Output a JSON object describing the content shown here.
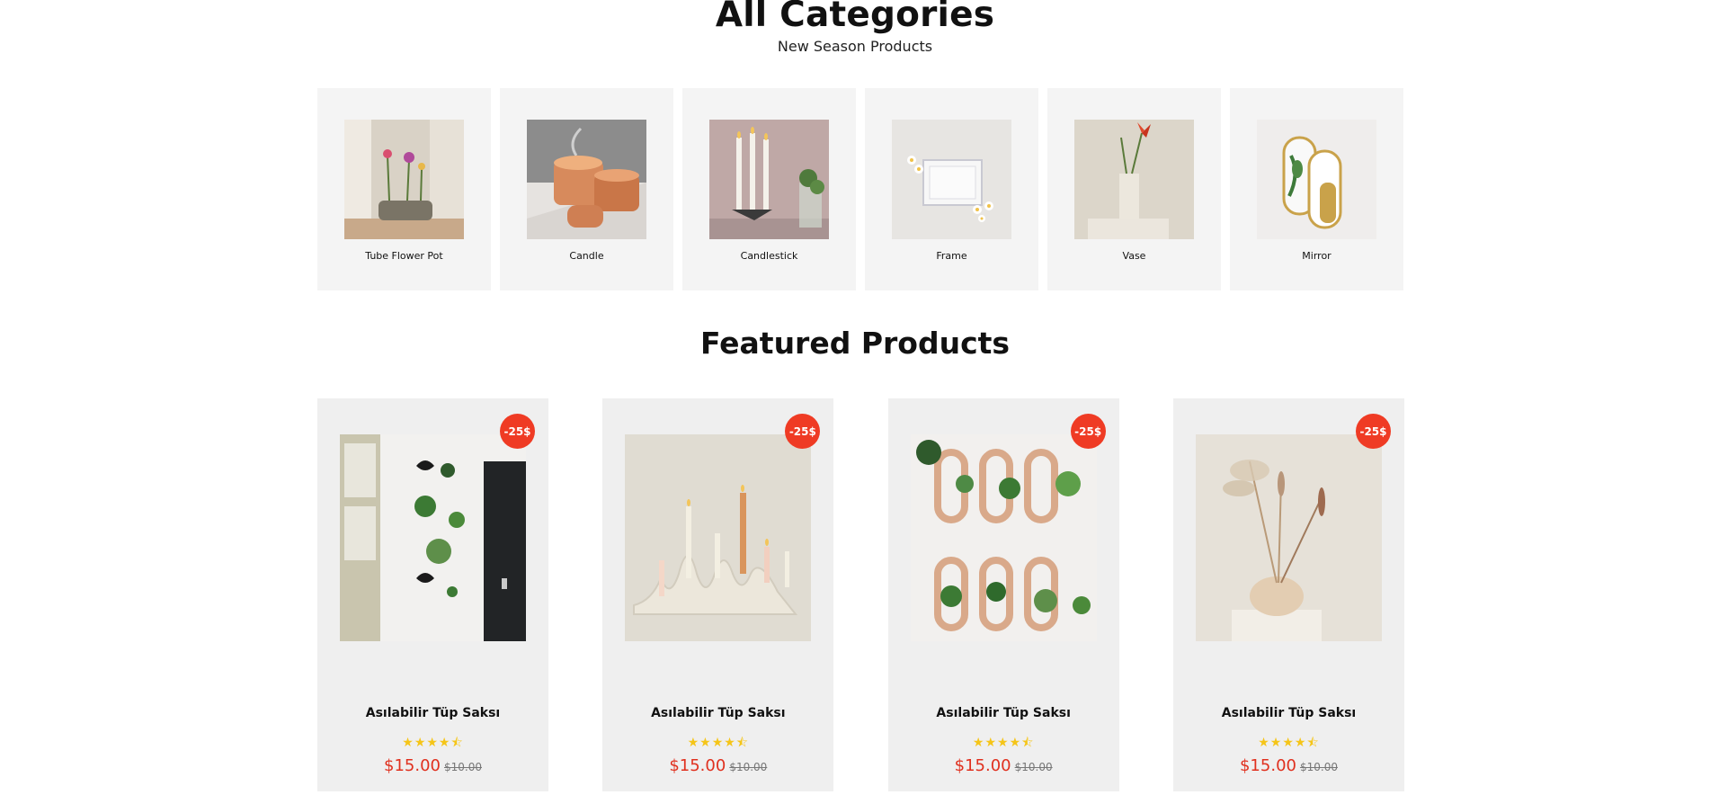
{
  "categories_section": {
    "title": "All Categories",
    "subtitle": "New Season Products",
    "items": [
      {
        "label": "Tube Flower Pot",
        "icon": "tube-flower-pot-image"
      },
      {
        "label": "Candle",
        "icon": "candle-image"
      },
      {
        "label": "Candlestick",
        "icon": "candlestick-image"
      },
      {
        "label": "Frame",
        "icon": "frame-image"
      },
      {
        "label": "Vase",
        "icon": "vase-image"
      },
      {
        "label": "Mirror",
        "icon": "mirror-image"
      }
    ]
  },
  "featured_section": {
    "title": "Featured Products",
    "products": [
      {
        "badge": "-25$",
        "name": "Asılabilir Tüp Saksı",
        "rating": 4.5,
        "stars": "★★★★⯪",
        "price": "$15.00",
        "old_price": "$10.00"
      },
      {
        "badge": "-25$",
        "name": "Asılabilir Tüp Saksı",
        "rating": 4.5,
        "stars": "★★★★⯪",
        "price": "$15.00",
        "old_price": "$10.00"
      },
      {
        "badge": "-25$",
        "name": "Asılabilir Tüp Saksı",
        "rating": 4.5,
        "stars": "★★★★⯪",
        "price": "$15.00",
        "old_price": "$10.00"
      },
      {
        "badge": "-25$",
        "name": "Asılabilir Tüp Saksı",
        "rating": 4.5,
        "stars": "★★★★⯪",
        "price": "$15.00",
        "old_price": "$10.00"
      }
    ]
  },
  "colors": {
    "badge": "#ef3b24",
    "price": "#e0301e",
    "star": "#f5c518",
    "card_bg": "#f4f4f4"
  }
}
